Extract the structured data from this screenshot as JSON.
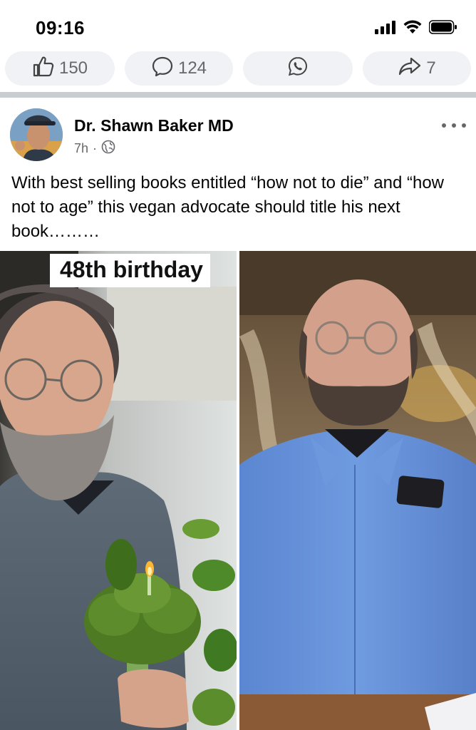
{
  "status_bar": {
    "time": "09:16"
  },
  "reactions": {
    "like_count": "150",
    "comment_count": "124",
    "share_count": "7"
  },
  "post": {
    "author": "Dr. Shawn Baker MD",
    "time": "7h",
    "separator": "·",
    "text": "With best selling books entitled “how not to die” and “how not to age” this vegan advocate should title his next book………",
    "image_caption": "48th birthday"
  }
}
